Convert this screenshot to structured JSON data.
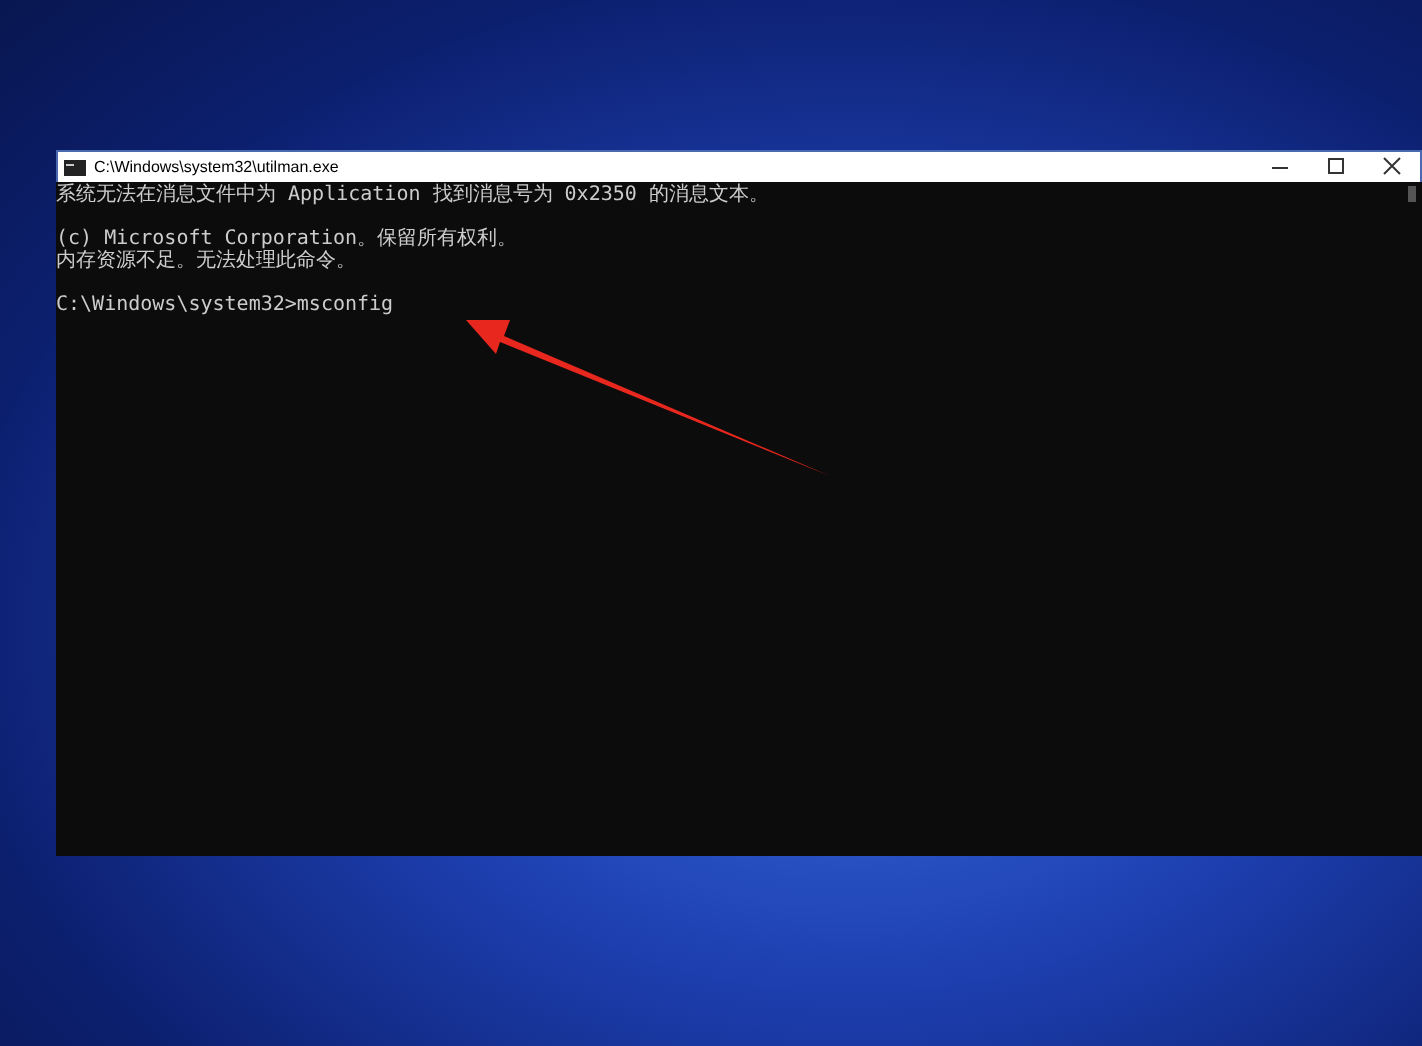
{
  "window": {
    "title": "C:\\Windows\\system32\\utilman.exe"
  },
  "console": {
    "blocks": [
      [
        "系统无法在消息文件中为 Application 找到消息号为 0x2350 的消息文本。"
      ],
      [
        "(c) Microsoft Corporation。保留所有权利。",
        "内存资源不足。无法处理此命令。"
      ],
      [
        "C:\\Windows\\system32>msconfig"
      ]
    ]
  }
}
